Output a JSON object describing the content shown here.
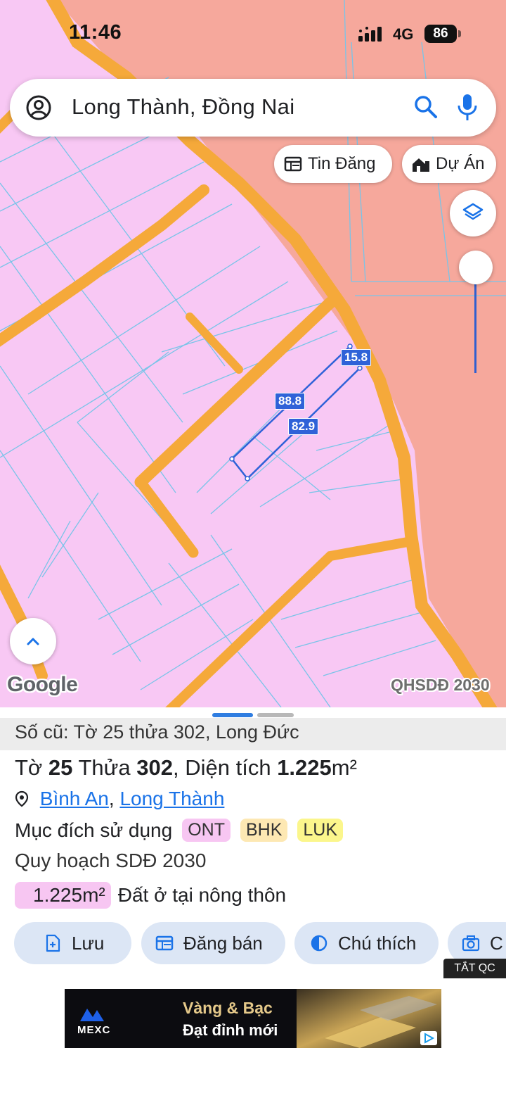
{
  "status_bar": {
    "time": "11:46",
    "network": "4G",
    "battery": "86"
  },
  "search": {
    "query": "Long Thành, Đồng Nai"
  },
  "chips": {
    "listings": "Tin Đăng",
    "projects": "Dự Án"
  },
  "map": {
    "attribution": "Google",
    "layer_label": "QHSDĐ 2030",
    "dimensions": [
      "15.8",
      "88.8",
      "82.9"
    ],
    "colors": {
      "rural_residential": "#f8c8f4",
      "road": "#f5a93a",
      "zone": "#f6a89c",
      "parcel_line": "#79c4e8",
      "measure": "#2f62d8"
    }
  },
  "parcel": {
    "old_info": "Số cũ: Tờ 25 thửa 302, Long Đức",
    "title_sheet_label": "Tờ",
    "sheet_no": "25",
    "plot_label": "Thửa",
    "plot_no": "302",
    "area_label": "Diện tích",
    "area_value": "1.225",
    "area_unit": "m²",
    "ward": "Bình An",
    "district": "Long Thành",
    "purpose_label": "Mục đích sử dụng",
    "purpose_tags": [
      "ONT",
      "BHK",
      "LUK"
    ],
    "plan_label": "Quy hoạch SDĐ 2030",
    "plan_area": "1.225m²",
    "plan_use": "Đất ở tại nông thôn"
  },
  "actions": {
    "save": "Lưu",
    "sell": "Đăng bán",
    "legend": "Chú thích",
    "capture": "C"
  },
  "ad": {
    "close_label": "TẮT QC",
    "brand": "MEXC",
    "headline": "Vàng & Bạc",
    "subline": "Đạt đỉnh mới"
  }
}
